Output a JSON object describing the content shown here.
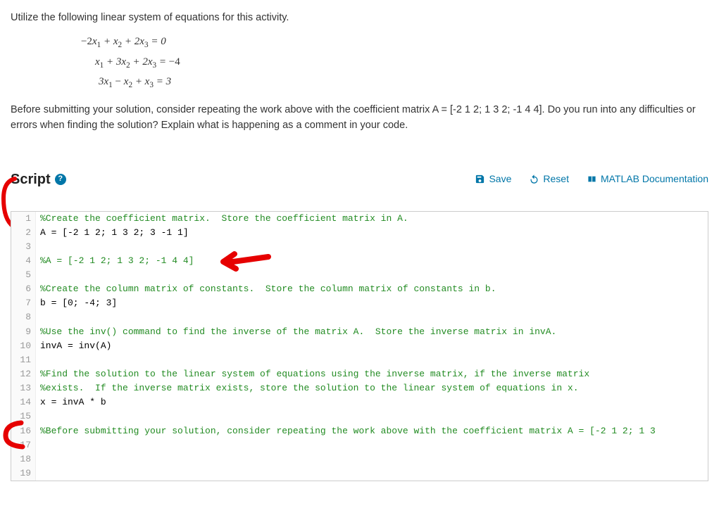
{
  "intro": "Utilize the following linear system of equations for this activity.",
  "eq1": "−2x₁ + x₂ + 2x₃ = 0",
  "eq2": "x₁ + 3x₂ + 2x₃ = −4",
  "eq3": "3x₁ − x₂ + x₃ = 3",
  "followup": "Before submitting your solution, consider repeating the work above with the coefficient matrix A = [-2 1 2; 1 3 2; -1 4 4].  Do you run into any difficulties or errors when finding the solution?  Explain what is happening as a comment in your code.",
  "script_label": "Script",
  "actions": {
    "save": "Save",
    "reset": "Reset",
    "docs": "MATLAB Documentation"
  },
  "code_lines": [
    {
      "n": 1,
      "segs": [
        {
          "t": "%Create the coefficient matrix.  Store the coefficient matrix in A.",
          "c": "tok-comment"
        }
      ]
    },
    {
      "n": 2,
      "segs": [
        {
          "t": "A = [-2 1 2; 1 3 2; 3 -1 1]",
          "c": ""
        }
      ]
    },
    {
      "n": 3,
      "segs": [
        {
          "t": "",
          "c": ""
        }
      ]
    },
    {
      "n": 4,
      "segs": [
        {
          "t": "%A = [-2 1 2; 1 3 2; -1 4 4]",
          "c": "tok-comment"
        }
      ]
    },
    {
      "n": 5,
      "segs": [
        {
          "t": "",
          "c": ""
        }
      ]
    },
    {
      "n": 6,
      "segs": [
        {
          "t": "%Create the column matrix of constants.  Store the column matrix of constants in b.",
          "c": "tok-comment"
        }
      ]
    },
    {
      "n": 7,
      "segs": [
        {
          "t": "b = [0; -4; 3]",
          "c": ""
        }
      ]
    },
    {
      "n": 8,
      "segs": [
        {
          "t": "",
          "c": ""
        }
      ]
    },
    {
      "n": 9,
      "segs": [
        {
          "t": "%Use the inv() command to find the inverse of the matrix A.  Store the inverse matrix in invA.",
          "c": "tok-comment"
        }
      ]
    },
    {
      "n": 10,
      "segs": [
        {
          "t": "invA = inv(A)",
          "c": ""
        }
      ]
    },
    {
      "n": 11,
      "segs": [
        {
          "t": "",
          "c": ""
        }
      ]
    },
    {
      "n": 12,
      "segs": [
        {
          "t": "%Find the solution to the linear system of equations using the inverse matrix, if the inverse matrix",
          "c": "tok-comment"
        }
      ]
    },
    {
      "n": 13,
      "segs": [
        {
          "t": "%exists.  If the inverse matrix exists, store the solution to the linear system of equations in x.",
          "c": "tok-comment"
        }
      ]
    },
    {
      "n": 14,
      "segs": [
        {
          "t": "x = invA * b",
          "c": ""
        }
      ]
    },
    {
      "n": 15,
      "segs": [
        {
          "t": "",
          "c": ""
        }
      ]
    },
    {
      "n": 16,
      "segs": [
        {
          "t": "%Before submitting your solution, consider repeating the work above with the coefficient matrix A = [-2 1 2; 1 3",
          "c": "tok-comment"
        }
      ]
    },
    {
      "n": 17,
      "segs": [
        {
          "t": "",
          "c": ""
        }
      ]
    },
    {
      "n": 18,
      "segs": [
        {
          "t": "",
          "c": ""
        }
      ]
    },
    {
      "n": 19,
      "segs": [
        {
          "t": "",
          "c": ""
        }
      ]
    }
  ]
}
